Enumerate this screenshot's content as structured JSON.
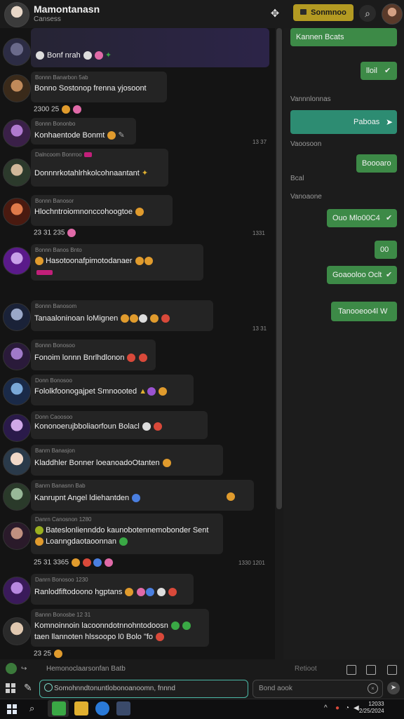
{
  "header": {
    "title": "Mamontanasn",
    "subtitle": "Cansess",
    "button_label": "Sonmnoo"
  },
  "messages": [
    {
      "meta": "",
      "text": "Bonf nrah",
      "time": "",
      "reactions": ""
    },
    {
      "meta": "Bonnn Banarbon 5ab",
      "text": "Bonno Sostonop frenna yjosoont",
      "time": "2300 25",
      "reactions": ""
    },
    {
      "meta": "Bonnn Bononbo",
      "text": "Konhaentode Bonmt",
      "time": "13 37",
      "reactions": ""
    },
    {
      "meta": "Dalncoom Bonrroo",
      "text": "Donnnrkotahlrhkolcohnaantant",
      "time": "",
      "reactions": ""
    },
    {
      "meta": "Bonnn Banosor",
      "text": "Hlochntroiomnonccohoogtoe",
      "time": "1331",
      "reactions": "23 31 235"
    },
    {
      "meta": "Bonnn Banos Bnto",
      "text": "Hasotoonafpimotodanaer",
      "time": "",
      "reactions": ""
    },
    {
      "meta": "Bonnn Banosom",
      "text": "Tanaaloninoan loMignen",
      "time": "13 31",
      "reactions": ""
    },
    {
      "meta": "Bonnn Bonosoo",
      "text": "Fonoim lonnn Bnrlhdlonon",
      "time": "",
      "reactions": ""
    },
    {
      "meta": "Donn Bonosoo",
      "text": "Fololkfoonogajpet Smnoooted",
      "time": "",
      "reactions": ""
    },
    {
      "meta": "Donn Caoosoo",
      "text": "Kononoerujbboliaorfoun Bolacl",
      "time": "",
      "reactions": ""
    },
    {
      "meta": "Banrn Banasjon",
      "text": "Kladdhler Bonner loeanoadoOtanten",
      "time": "",
      "reactions": ""
    },
    {
      "meta": "Banrn Banasnn Bab",
      "text": "Kanrupnt Angel ldiehantden",
      "time": "",
      "reactions": ""
    },
    {
      "meta": "Danrn Canosnon 1280",
      "text": "Bateslonliennddo kaunobotennemobonder Sent",
      "text2": "Loanngdaotaoonnan",
      "time": "1330 1201",
      "reactions": "25 31 3365"
    },
    {
      "meta": "Danrn Bonosoo 1230",
      "text": "Ranlodfiftodoono hgptans",
      "time": "",
      "reactions": ""
    },
    {
      "meta": "Bannn Bonosbe 12 31",
      "text": "Komnoinnoin lacoonndotnnohntodoosn",
      "text2": "taen llannoten hlssoopo l0 Bolo \"fo",
      "time": "",
      "reactions": "23 25"
    }
  ],
  "sidebar": {
    "top_bar": "Kannen Bcats",
    "items": [
      {
        "type": "green",
        "label": "lloil"
      },
      {
        "type": "label",
        "label": "Vannnlonnas"
      },
      {
        "type": "teal",
        "label": "Paboas"
      },
      {
        "type": "label",
        "label": "Vaoosoon"
      },
      {
        "type": "green",
        "label": "Boooaro"
      },
      {
        "type": "label",
        "label": "Bcal"
      },
      {
        "type": "label",
        "label": "Vanoaone"
      },
      {
        "type": "green",
        "label": "Ouo Mlo00C4"
      },
      {
        "type": "green",
        "label": "00"
      },
      {
        "type": "green",
        "label": "Goaooloo Oclt"
      },
      {
        "type": "green",
        "label": "Tanooeoo4l W"
      }
    ]
  },
  "composer": {
    "context_text": "Hemonoclaarsonfan Batb",
    "context_right": "Retioot",
    "input_text": "Somohnndtonuntlobonoanoomn, fnnnd",
    "search_placeholder": "Bond aook"
  },
  "taskbar": {
    "time": "12033",
    "date": "2/25/2024"
  }
}
